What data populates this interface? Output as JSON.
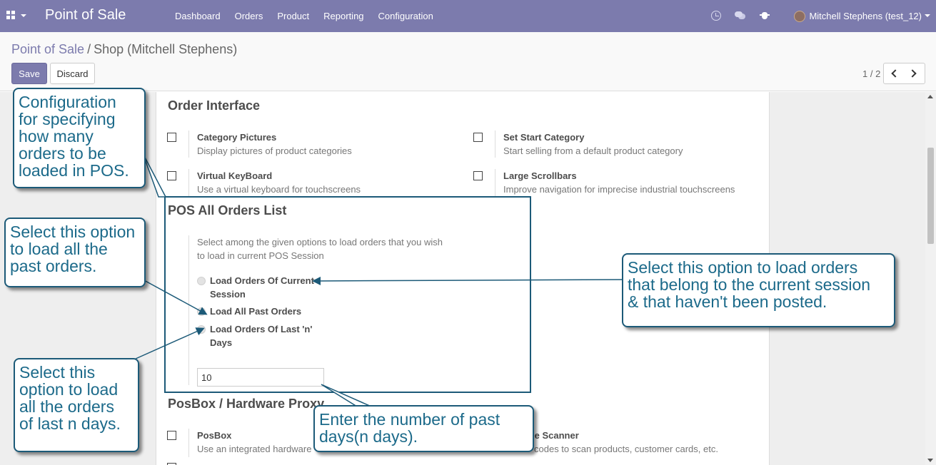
{
  "navbar": {
    "apps_icon": "grid-icon",
    "brand": "Point of Sale",
    "menu": [
      "Dashboard",
      "Orders",
      "Product",
      "Reporting",
      "Configuration"
    ],
    "systray_icons": [
      "clock-icon",
      "chat-icon",
      "bug-icon"
    ],
    "user": "Mitchell Stephens (test_12)",
    "color": "#7c7bad"
  },
  "control": {
    "breadcrumb_root": "Point of Sale",
    "breadcrumb_sep": "/",
    "breadcrumb_current": "Shop (Mitchell Stephens)",
    "save_label": "Save",
    "discard_label": "Discard",
    "pager": "1 / 2"
  },
  "order_interface": {
    "title": "Order Interface",
    "options": [
      {
        "label": "Category Pictures",
        "desc": "Display pictures of product categories",
        "checked": false
      },
      {
        "label": "Set Start Category",
        "desc": "Start selling from a default product category",
        "checked": false
      },
      {
        "label": "Virtual KeyBoard",
        "desc": "Use a virtual keyboard for touchscreens",
        "checked": false
      },
      {
        "label": "Large Scrollbars",
        "desc": "Improve navigation for imprecise industrial touchscreens",
        "checked": false
      }
    ]
  },
  "orders_list": {
    "title": "POS All Orders List",
    "desc_line1": "Select among the given options to load orders that you wish",
    "desc_line2": "to load in current POS Session",
    "radios": [
      {
        "line1": "Load Orders Of Current",
        "line2": "Session",
        "checked": false
      },
      {
        "line1": "Load All Past Orders",
        "line2": "",
        "checked": false
      },
      {
        "line1": "Load Orders Of Last 'n'",
        "line2": "Days",
        "checked": true
      }
    ],
    "days_value": "10"
  },
  "posbox": {
    "title": "PosBox / Hardware Proxy",
    "options": [
      {
        "label": "PosBox",
        "desc": "Use an integrated hardware"
      },
      {
        "label": "le Scanner",
        "desc": "codes to scan products, customer cards, etc."
      }
    ]
  },
  "callouts": {
    "config": [
      "Configuration",
      "for specifying",
      "how many",
      "orders to be",
      "loaded in POS."
    ],
    "all_past": [
      "Select this option",
      "to load all the",
      "past orders."
    ],
    "current_session": [
      "Select this option to load orders",
      "that belong to the current session",
      "& that haven't been posted."
    ],
    "last_n": [
      "Select this",
      "option to load",
      "all the orders",
      "of last n days."
    ],
    "n_days": [
      "Enter the number of past",
      "days(n days)."
    ]
  },
  "accent_color": "#1c5a78"
}
